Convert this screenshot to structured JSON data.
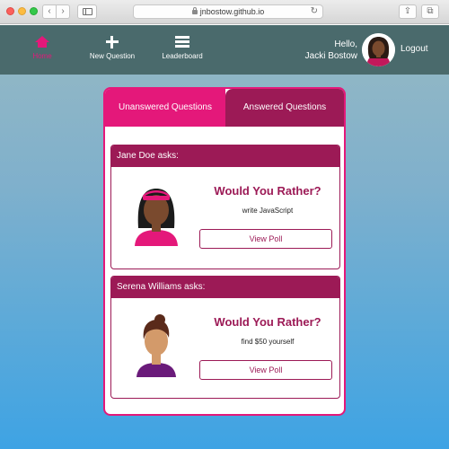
{
  "browser": {
    "url": "jnbostow.github.io"
  },
  "nav": {
    "items": [
      {
        "label": "Home",
        "icon": "home-icon",
        "active": true
      },
      {
        "label": "New Question",
        "icon": "plus-icon"
      },
      {
        "label": "Leaderboard",
        "icon": "list-icon"
      }
    ],
    "greeting_line1": "Hello,",
    "greeting_line2": "Jacki Bostow",
    "logout_label": "Logout"
  },
  "tabs": {
    "unanswered": "Unanswered Questions",
    "answered": "Answered Questions",
    "active": "unanswered"
  },
  "questions": [
    {
      "asker": "Jane Doe asks:",
      "title": "Would You Rather?",
      "option_preview": "write JavaScript",
      "button": "View Poll"
    },
    {
      "asker": "Serena Williams asks:",
      "title": "Would You Rather?",
      "option_preview": "find $50 yourself",
      "button": "View Poll"
    }
  ],
  "colors": {
    "accent": "#e4187a",
    "dark_accent": "#9c1a56",
    "nav_bg": "#4a6a6c"
  }
}
